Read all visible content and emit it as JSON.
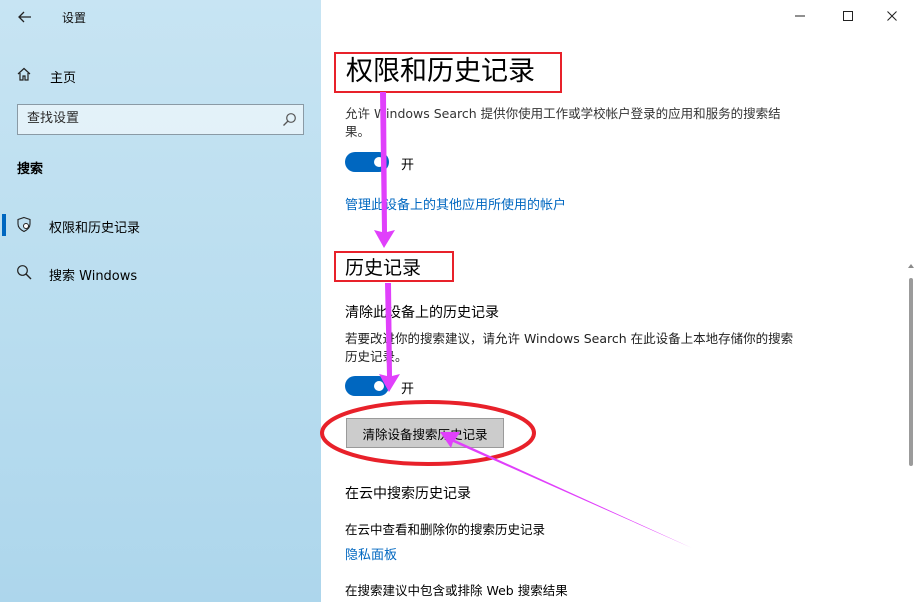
{
  "window": {
    "title": "设置",
    "controls": {
      "minimize": "minimize-icon",
      "maximize": "maximize-icon",
      "close": "close-icon"
    }
  },
  "sidebar": {
    "home_label": "主页",
    "search_placeholder": "查找设置",
    "section_label": "搜索",
    "items": [
      {
        "label": "权限和历史记录",
        "icon": "shield-search-icon",
        "selected": true
      },
      {
        "label": "搜索 Windows",
        "icon": "search-icon",
        "selected": false
      }
    ]
  },
  "main": {
    "permissions": {
      "title": "权限和历史记录",
      "description": "允许 Windows Search 提供你使用工作或学校帐户登录的应用和服务的搜索结果。",
      "toggle_state": "开",
      "link_manage_accounts": "管理此设备上的其他应用所使用的帐户"
    },
    "history": {
      "title": "历史记录",
      "clear_subtitle": "清除此设备上的历史记录",
      "description": "若要改进你的搜索建议，请允许 Windows Search 在此设备上本地存储你的搜索历史记录。",
      "toggle_state": "开",
      "clear_button": "清除设备搜索历史记录"
    },
    "cloud": {
      "subtitle": "在云中搜索历史记录",
      "description": "在云中查看和删除你的搜索历史记录",
      "link_privacy": "隐私面板"
    },
    "web_results": {
      "description": "在搜索建议中包含或排除 Web 搜索结果"
    }
  },
  "colors": {
    "accent": "#0067c0",
    "annotation_red": "#e8212a",
    "annotation_magenta": "#e040fb",
    "sidebar_bg": "#b9ddef"
  }
}
